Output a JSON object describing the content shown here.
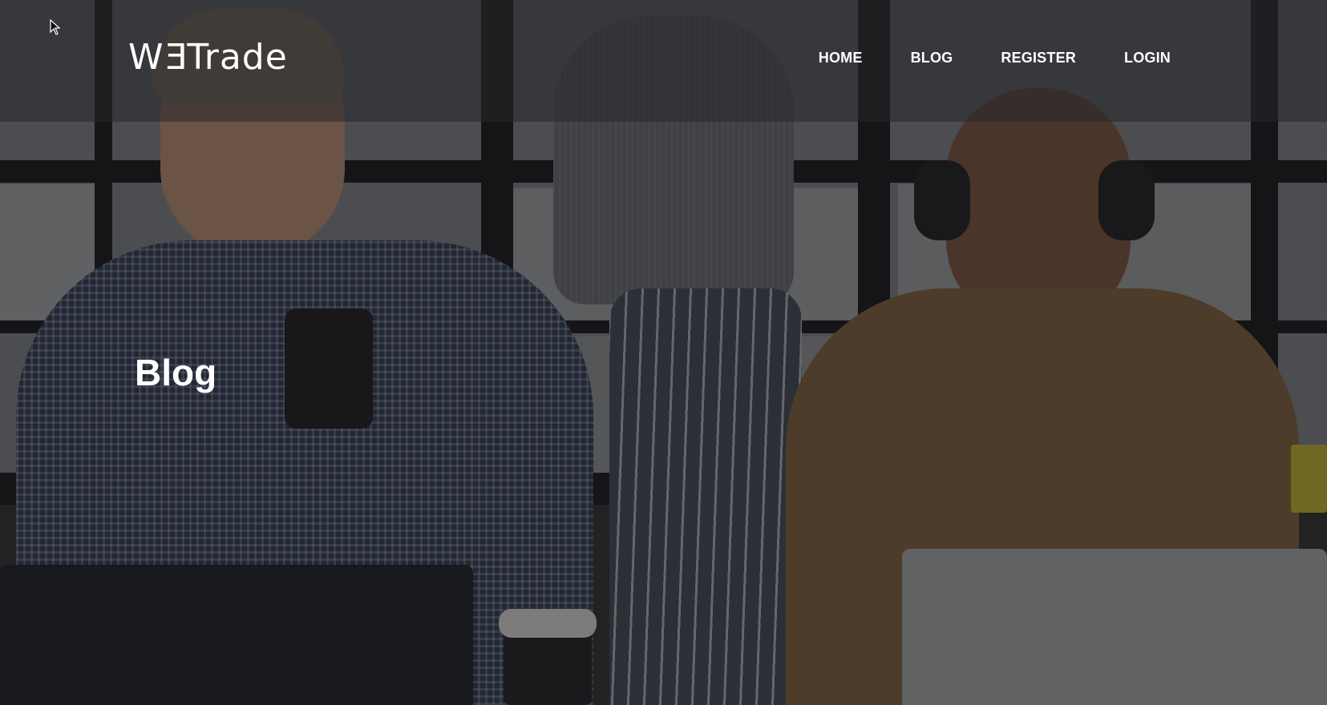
{
  "brand": {
    "logo_prefix": "W",
    "logo_mirrored": "E",
    "logo_suffix": "Trade"
  },
  "nav": {
    "items": [
      {
        "label": "HOME"
      },
      {
        "label": "BLOG"
      },
      {
        "label": "REGISTER"
      },
      {
        "label": "LOGIN"
      }
    ]
  },
  "hero": {
    "title": "Blog"
  },
  "colors": {
    "header_band": "#2c2c30",
    "text": "#ffffff"
  },
  "icons": {
    "cursor": "mouse-pointer-icon"
  }
}
